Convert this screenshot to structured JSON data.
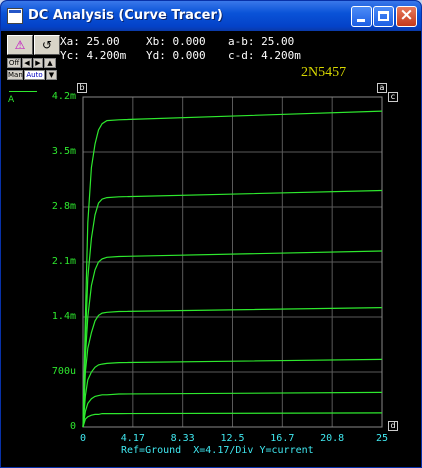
{
  "window": {
    "title": "DC Analysis (Curve Tracer)"
  },
  "toolbar": {
    "btn1_glyph": "⚠",
    "btn2_glyph": "↺",
    "off_label": "Off",
    "man_label": "Man",
    "auto_label": "Auto"
  },
  "cursors": {
    "xa": "Xa: 25.00",
    "xb": "Xb: 0.000",
    "a_minus_b": "a-b: 25.00",
    "yc": "Yc: 4.200m",
    "yd": "Yd: 0.000",
    "c_minus_d": "c-d: 4.200m"
  },
  "device_label": "2N5457",
  "legend": {
    "label": "A"
  },
  "markers": {
    "a": "a",
    "b": "b",
    "c": "c",
    "d": "d"
  },
  "status": "Ref=Ground  X=4.17/Div Y=current",
  "colors": {
    "trace": "#2ee82e",
    "grid": "#5a5a5a",
    "axis_text": "#40e8f0",
    "y_text": "#2ee82e",
    "device": "#d8d800"
  },
  "chart_data": {
    "type": "line",
    "x_ticks": [
      "0",
      "4.17",
      "8.33",
      "12.5",
      "16.7",
      "20.8",
      "25"
    ],
    "y_ticks": [
      "0",
      "700u",
      "1.4m",
      "2.1m",
      "2.8m",
      "3.5m",
      "4.2m"
    ],
    "xlim": [
      0,
      25
    ],
    "ylim": [
      0,
      0.0042
    ],
    "grid": true,
    "series": [
      {
        "x": [
          0,
          0.2,
          0.4,
          0.7,
          1.0,
          1.3,
          1.6,
          2.0,
          3.0,
          25
        ],
        "y": [
          0,
          0.0014,
          0.0026,
          0.0033,
          0.0036,
          0.00378,
          0.00386,
          0.0039,
          0.00391,
          0.00402
        ]
      },
      {
        "x": [
          0,
          0.2,
          0.4,
          0.7,
          1.0,
          1.3,
          1.6,
          2.0,
          3.0,
          25
        ],
        "y": [
          0,
          0.0011,
          0.0019,
          0.0024,
          0.0027,
          0.00285,
          0.0029,
          0.00292,
          0.00293,
          0.00301
        ]
      },
      {
        "x": [
          0,
          0.2,
          0.4,
          0.7,
          1.0,
          1.3,
          1.6,
          2.0,
          3.0,
          25
        ],
        "y": [
          0,
          0.0009,
          0.0014,
          0.0018,
          0.002,
          0.0021,
          0.00214,
          0.00216,
          0.00217,
          0.00224
        ]
      },
      {
        "x": [
          0,
          0.2,
          0.4,
          0.7,
          1.0,
          1.3,
          1.6,
          2.0,
          3.0,
          25
        ],
        "y": [
          0,
          0.0007,
          0.001,
          0.0012,
          0.00135,
          0.00142,
          0.00145,
          0.00146,
          0.00147,
          0.00152
        ]
      },
      {
        "x": [
          0,
          0.2,
          0.4,
          0.7,
          1.0,
          1.3,
          1.6,
          2.0,
          3.0,
          25
        ],
        "y": [
          0,
          0.0004,
          0.0006,
          0.0007,
          0.00076,
          0.00079,
          0.0008,
          0.00081,
          0.00082,
          0.00086
        ]
      },
      {
        "x": [
          0,
          0.2,
          0.4,
          0.7,
          1.0,
          1.3,
          1.6,
          2.0,
          3.0,
          25
        ],
        "y": [
          0,
          0.0002,
          0.0003,
          0.00036,
          0.00039,
          0.0004,
          0.00041,
          0.00041,
          0.00042,
          0.00044
        ]
      },
      {
        "x": [
          0,
          0.2,
          0.4,
          0.7,
          1.0,
          1.3,
          1.6,
          2.0,
          3.0,
          25
        ],
        "y": [
          0,
          0.0001,
          0.00013,
          0.00015,
          0.00016,
          0.00016,
          0.00017,
          0.00017,
          0.00017,
          0.00018
        ]
      }
    ]
  }
}
